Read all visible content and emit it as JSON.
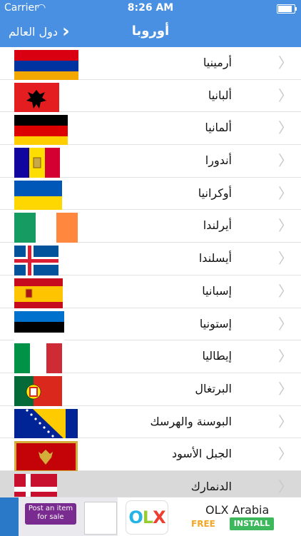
{
  "status_bar": {
    "carrier": "Carrier",
    "time": "8:26 AM"
  },
  "navbar": {
    "title": "أوروبا",
    "back_label": "دول العالم"
  },
  "countries": [
    {
      "name": "أرمينيا",
      "flag": "armenia-flag"
    },
    {
      "name": "ألبانيا",
      "flag": "albania-flag"
    },
    {
      "name": "ألمانيا",
      "flag": "germany-flag"
    },
    {
      "name": "أندورا",
      "flag": "andorra-flag"
    },
    {
      "name": "أوكرانيا",
      "flag": "ukraine-flag"
    },
    {
      "name": "أيرلندا",
      "flag": "ireland-flag"
    },
    {
      "name": "أيسلندا",
      "flag": "iceland-flag"
    },
    {
      "name": "إسبانيا",
      "flag": "spain-flag"
    },
    {
      "name": "إستونيا",
      "flag": "estonia-flag"
    },
    {
      "name": "إيطاليا",
      "flag": "italy-flag"
    },
    {
      "name": "البرتغال",
      "flag": "portugal-flag"
    },
    {
      "name": "البوسنة والهرسك",
      "flag": "bosnia-flag"
    },
    {
      "name": "الجبل الأسود",
      "flag": "montenegro-flag"
    },
    {
      "name": "الدنمارك",
      "flag": "denmark-flag"
    }
  ],
  "ad": {
    "post_label": "Post an item for sale",
    "app_name": "OLX Arabia",
    "free_label": "FREE",
    "install_label": "INSTALL",
    "logo_o": "O",
    "logo_l": "L",
    "logo_x": "X"
  }
}
